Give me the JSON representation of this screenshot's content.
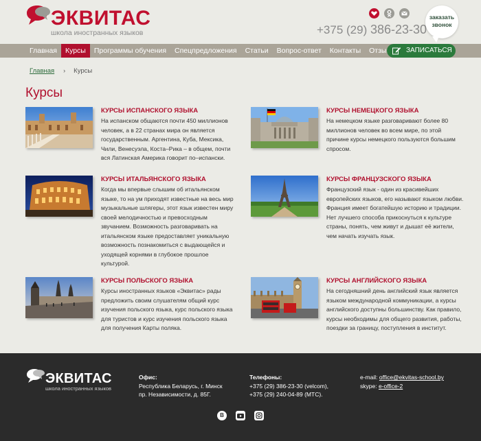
{
  "header": {
    "logo_title": "ЭКВИТАС",
    "logo_subtitle": "школа иностранных языков",
    "phone_prefix": "+375 (29)",
    "phone_number": "386-23-30",
    "callback_line1": "заказать",
    "callback_line2": "звонок",
    "icons": [
      "vk-heart-icon",
      "odnoklassniki-icon",
      "mail-icon"
    ],
    "accent": "#c0102f"
  },
  "nav": {
    "items": [
      {
        "label": "Главная",
        "active": false
      },
      {
        "label": "Курсы",
        "active": true
      },
      {
        "label": "Программы обучения",
        "active": false
      },
      {
        "label": "Спецпредложения",
        "active": false
      },
      {
        "label": "Статьи",
        "active": false
      },
      {
        "label": "Вопрос-ответ",
        "active": false
      },
      {
        "label": "Контакты",
        "active": false
      },
      {
        "label": "Отзывы",
        "active": false
      }
    ],
    "signup_label": "ЗАПИСАТЬСЯ"
  },
  "breadcrumb": {
    "home": "Главная",
    "separator": "›",
    "current": "Курсы"
  },
  "page_title": "Курсы",
  "courses": [
    {
      "title": "КУРСЫ ИСПАНСКОГО ЯЗЫКА",
      "text": "На испанском общаются почти 450 миллионов человек, а в 22 странах мира он является государственным. Аргентина, Куба, Мексика, Чили, Венесуэла, Коста–Рика – в общем, почти вся Латинская Америка говорит по–испански.",
      "image": "spain-plaza-image"
    },
    {
      "title": "КУРСЫ НЕМЕЦКОГО ЯЗЫКА",
      "text": "На немецком языке разговаривают более 80 миллионов человек во всем мире, по этой причине курсы немецкого пользуются большим спросом.",
      "image": "reichstag-image"
    },
    {
      "title": "КУРСЫ ИТАЛЬЯНСКОГО ЯЗЫКА",
      "text": "Когда мы впервые слышим об итальянском языке, то на ум приходят известные на весь мир музыкальные шлягеры, этот язык известен миру своей мелодичностью и превосходным звучанием. Возможность разговаривать на итальянском языке предоставляет уникальную возможность познакомиться с выдающейся и уходящей корнями в глубокое прошлое культурой.",
      "image": "colosseum-image"
    },
    {
      "title": "КУРСЫ ФРАНЦУЗСКОГО ЯЗЫКА",
      "text": "Французский язык - один из красивейших европейских языков, его называют языком любви. Франция имеет богатейшую историю и традиции. Нет лучшего способа прикоснуться к культуре страны, понять, чем живут и дышат её жители, чем начать изучать язык.",
      "image": "eiffel-tower-image"
    },
    {
      "title": "КУРСЫ ПОЛЬСКОГО ЯЗЫКА",
      "text": "Курсы иностранных языков «Эквитас» рады предложить своим слушателям общий курс изучения польского языка, курс польского языка для туристов и курс изучения польского языка для получения Карты поляка.",
      "image": "prague-bridge-image"
    },
    {
      "title": "КУРСЫ АНГЛИЙСКОГО ЯЗЫКА",
      "text": "На сегодняшний день английский язык является языком международной коммуникации, а курсы английского доступны большинству. Как правило, курсы необходимы для общего развития, работы, поездки за границу, поступления в институт.",
      "image": "london-bigben-image"
    }
  ],
  "footer": {
    "logo_title": "ЭКВИТАС",
    "logo_subtitle": "школа иностранных языков",
    "office_label": "Офис:",
    "office_line1": "Республика Беларусь, г. Минск",
    "office_line2": "пр. Независимости, д. 85Г.",
    "phones_label": "Телефоны:",
    "phone1": "+375 (29) 386-23-30 (velcom),",
    "phone2": "+375 (29) 240-04-89 (МТС).",
    "email_label": "e-mail:",
    "email": "office@ekvitas-school.by",
    "skype_label": "skype:",
    "skype": "e-office-2",
    "social": [
      "vk-icon",
      "youtube-icon",
      "instagram-icon"
    ]
  }
}
